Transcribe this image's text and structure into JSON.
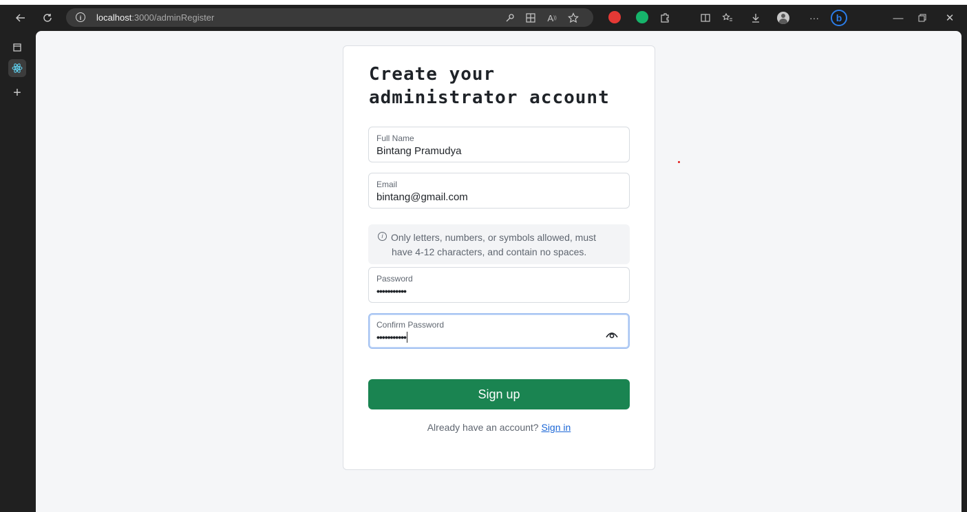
{
  "browser": {
    "url_host": "localhost",
    "url_path": ":3000/adminRegister",
    "icons": {
      "back": "back-arrow-icon",
      "refresh": "refresh-icon",
      "site_info": "info-icon"
    }
  },
  "form": {
    "title_line1": "Create your",
    "title_line2": "administrator account",
    "fullname_label": "Full Name",
    "fullname_value": "Bintang Pramudya",
    "email_label": "Email",
    "email_value": "bintang@gmail.com",
    "hint_line1": "Only letters, numbers, or symbols allowed, must",
    "hint_line2": "have 4-12 characters, and contain no spaces.",
    "password_label": "Password",
    "password_value": "•••••••••••",
    "confirm_label": "Confirm Password",
    "confirm_value": "•••••••••••",
    "signup_label": "Sign up",
    "footer_text": "Already have an account?",
    "signin_label": "Sign in"
  },
  "colors": {
    "accent": "#1a8451",
    "link": "#1a66d6",
    "focus": "#a7c4f2"
  }
}
